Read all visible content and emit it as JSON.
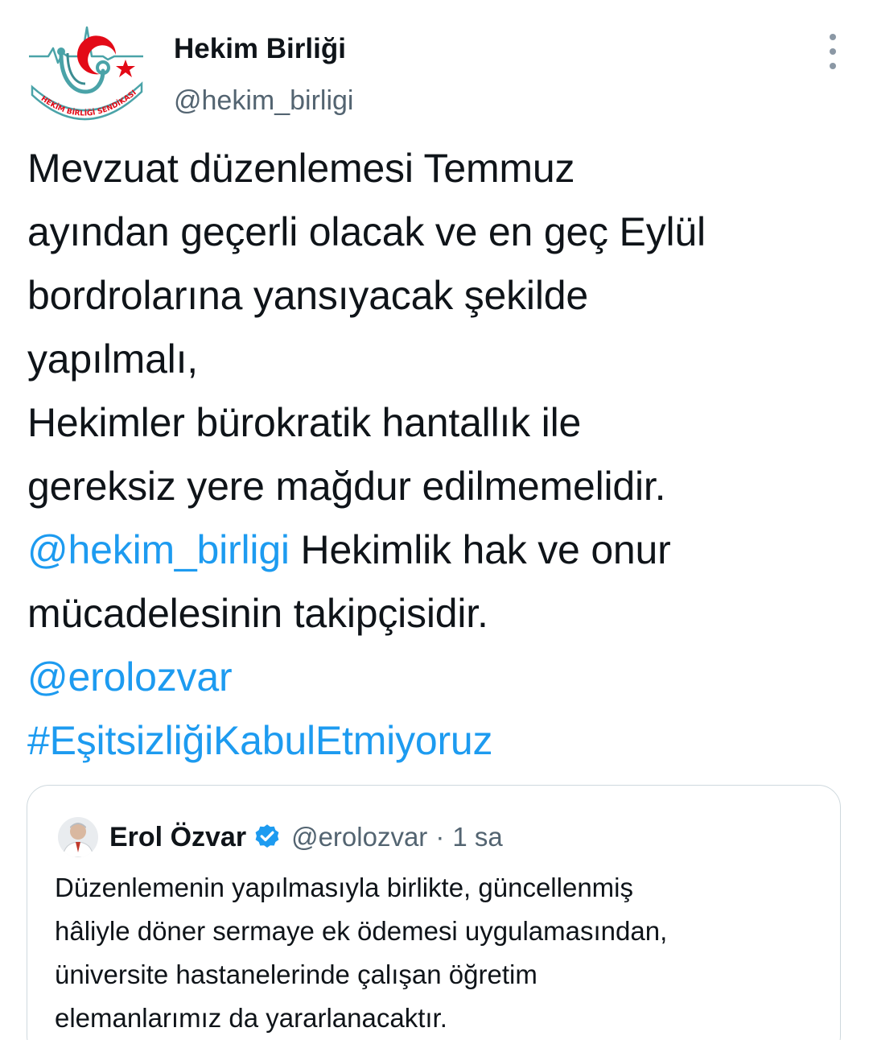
{
  "author": {
    "display_name": "Hekim Birliği",
    "handle": "@hekim_birligi",
    "avatar_icon": "hekim-birligi-sendikasi-logo-icon",
    "avatar_logo_text": "HEKİM BİRLİĞİ SENDİKASI"
  },
  "more_icon": "more-options-vertical-icon",
  "tweet": {
    "lines": {
      "l1": "Mevzuat düzenlemesi Temmuz",
      "l2": "ayından geçerli olacak ve en geç Eylül",
      "l3": "bordrolarına yansıyacak şekilde",
      "l4": "yapılmalı,",
      "l5": "Hekimler bürokratik hantallık ile",
      "l6": "gereksiz yere mağdur edilmemelidir.",
      "l7_mention": "@hekim_birligi",
      "l7_rest": " Hekimlik hak ve onur",
      "l8": "mücadelesinin takipçisidir.",
      "l9_mention": "@erolozvar",
      "l10_hashtag": "#EşitsizliğiKabulEtmiyoruz"
    }
  },
  "quoted_tweet": {
    "display_name": "Erol Özvar",
    "verified_icon": "verified-badge-icon",
    "handle": "@erolozvar",
    "separator": "·",
    "time": "1 sa",
    "lines": {
      "l1": "Düzenlemenin yapılmasıyla birlikte, güncellenmiş",
      "l2": "hâliyle döner sermaye ek ödemesi uygulamasından,",
      "l3": "üniversite hastanelerinde çalışan öğretim",
      "l4": "elemanlarımız da yararlanacaktır."
    }
  },
  "colors": {
    "link": "#1d9bf0",
    "text": "#0f1419",
    "secondary": "#536471",
    "border": "#cfd9de",
    "logo_red": "#e30a17",
    "logo_teal": "#4aa3a8"
  }
}
